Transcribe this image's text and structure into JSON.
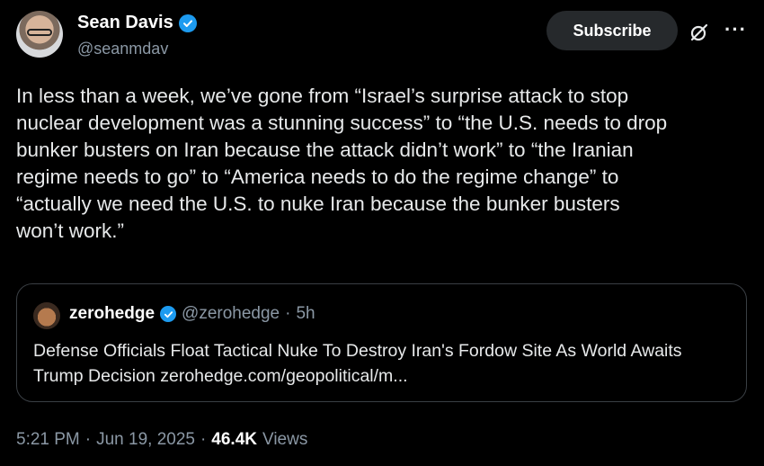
{
  "author": {
    "name": "Sean Davis",
    "handle": "@seanmdav"
  },
  "actions": {
    "subscribe_label": "Subscribe",
    "more_label": "···"
  },
  "tweet": {
    "text": "In less than a week, we’ve gone from “Israel’s surprise attack to stop\nnuclear development was a stunning success” to “the U.S. needs to drop\nbunker busters on Iran because the attack didn’t work” to “the Iranian\nregime needs to go” to “America needs to do the regime change” to\n“actually we need the U.S. to nuke Iran because the bunker busters\nwon’t work.”"
  },
  "quoted": {
    "name": "zerohedge",
    "handle": "@zerohedge",
    "separator": "·",
    "time": "5h",
    "text": "Defense Officials Float Tactical Nuke To Destroy Iran's Fordow Site As World Awaits Trump Decision zerohedge.com/geopolitical/m..."
  },
  "meta": {
    "time": "5:21 PM",
    "sep1": "·",
    "date": "Jun 19, 2025",
    "sep2": "·",
    "views_count": "46.4K",
    "views_label": "Views"
  },
  "colors": {
    "background": "#000000",
    "verified": "#1d9bf0",
    "secondary_text": "#8b98a5"
  },
  "icons": [
    "verified-badge-icon",
    "grok-icon",
    "more-icon"
  ]
}
